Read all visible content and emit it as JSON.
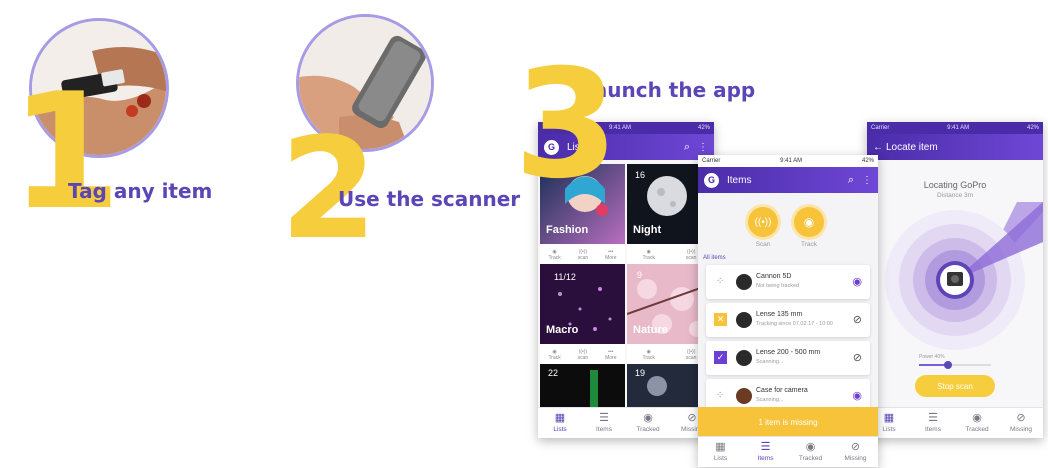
{
  "steps": [
    {
      "number": "1",
      "label": "Tag any item"
    },
    {
      "number": "2",
      "label": "Use the scanner"
    },
    {
      "number": "3",
      "label": "Launch the app"
    }
  ],
  "phone_lists": {
    "status_time": "9:41 AM",
    "status_battery": "42%",
    "title": "Lists",
    "tiles": [
      {
        "label": "Fashion"
      },
      {
        "label": "Night",
        "count": "16"
      },
      {
        "label": "Macro",
        "count": "11/12"
      },
      {
        "label": "Nature",
        "count": "9"
      },
      {
        "label": "",
        "count": "22"
      },
      {
        "label": "",
        "count": "19"
      }
    ],
    "tile_actions": [
      "Track",
      "scan",
      "More"
    ]
  },
  "phone_items": {
    "status_carrier": "Carrier",
    "status_time": "9:41 AM",
    "status_battery": "42%",
    "title": "Items",
    "scan_label": "Scan",
    "track_label": "Track",
    "section_label": "All items",
    "items": [
      {
        "title": "Cannon 5D",
        "subtitle": "Not being tracked"
      },
      {
        "title": "Lense 135 mm",
        "subtitle": "Tracking since 07.02.17 - 10:00"
      },
      {
        "title": "Lense 200 - 500 mm",
        "subtitle": "Scanning..."
      },
      {
        "title": "Case for camera",
        "subtitle": "Scanning..."
      }
    ],
    "missing_banner": "1 item is missing"
  },
  "phone_locate": {
    "status_carrier": "Carrier",
    "status_time": "9:41 AM",
    "status_battery": "42%",
    "back_title": "Locate item",
    "locating_title": "Locating GoPro",
    "distance": "Distance 3m",
    "power_label": "Power 40%",
    "power_level": 0.4,
    "stop_button": "Stop scan"
  },
  "nav": {
    "lists": "Lists",
    "items": "Items",
    "tracked": "Tracked",
    "missing": "Missing"
  },
  "colors": {
    "yellow": "#f6cd3c",
    "purple": "#5b45b7",
    "deep_purple": "#4a2ca8"
  }
}
